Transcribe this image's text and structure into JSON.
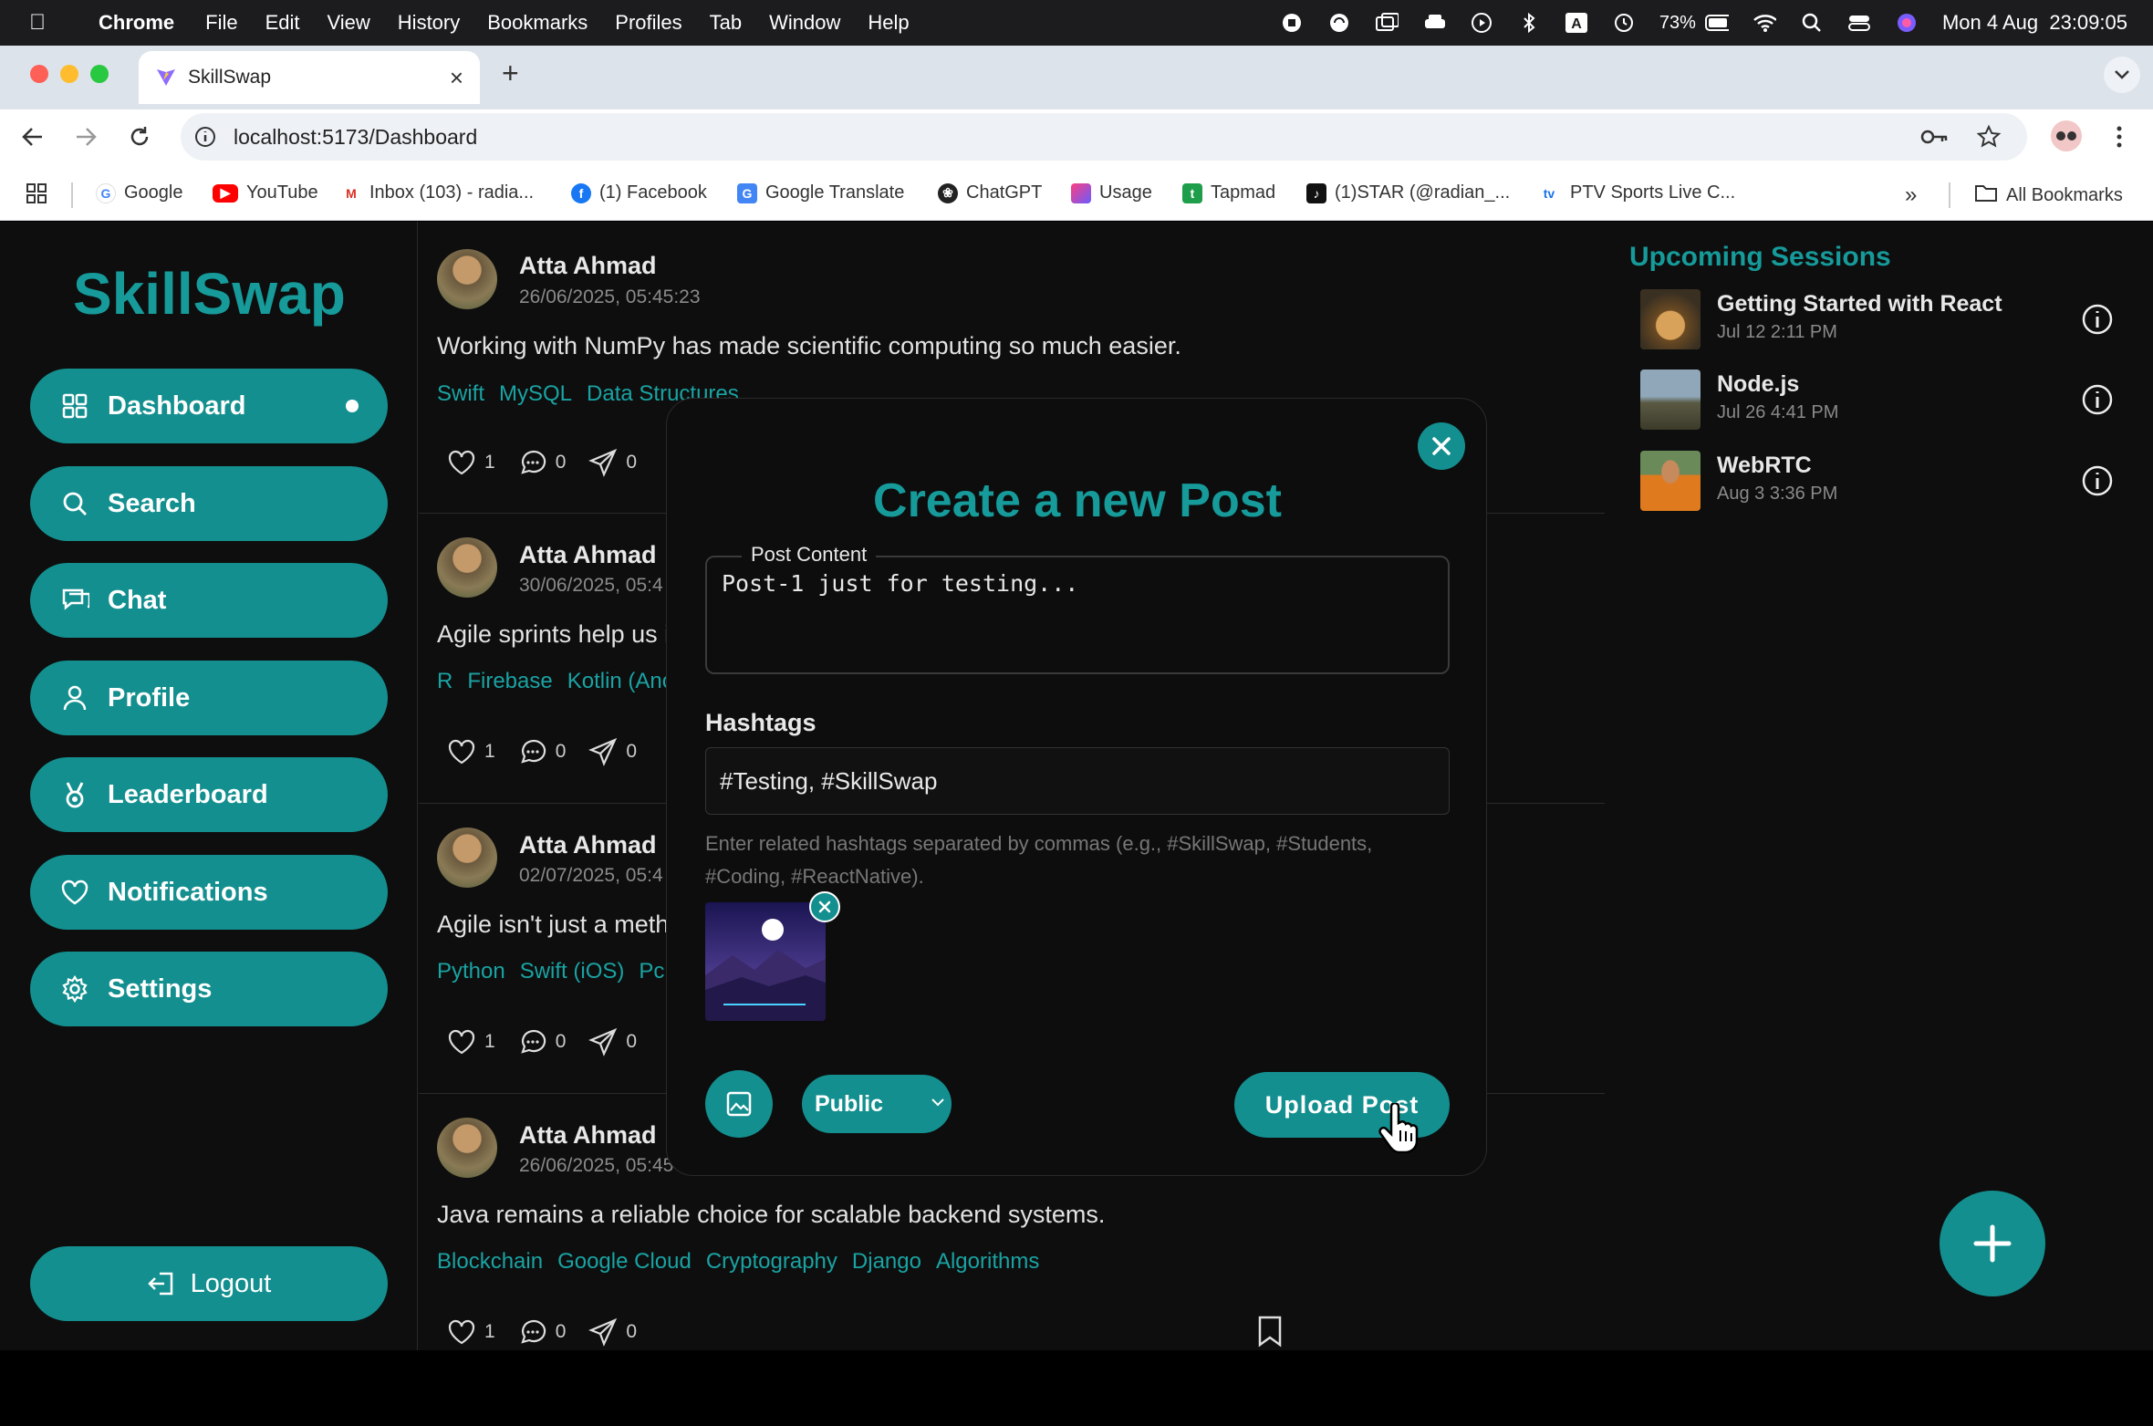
{
  "menubar": {
    "app": "Chrome",
    "items": [
      "File",
      "Edit",
      "View",
      "History",
      "Bookmarks",
      "Profiles",
      "Tab",
      "Window",
      "Help"
    ],
    "battery": "73%",
    "datetime": "Mon 4 Aug  23:09:05"
  },
  "browser": {
    "tab_title": "SkillSwap",
    "url": "localhost:5173/Dashboard",
    "bookmarks": [
      "Google",
      "YouTube",
      "Inbox (103) - radia...",
      "(1) Facebook",
      "Google Translate",
      "ChatGPT",
      "Usage",
      "Tapmad",
      "(1)STAR (@radian_...",
      "PTV Sports Live C..."
    ],
    "all_bookmarks": "All Bookmarks"
  },
  "sidebar": {
    "logo": "SkillSwap",
    "items": [
      {
        "label": "Dashboard",
        "icon": "grid-icon"
      },
      {
        "label": "Search",
        "icon": "search-icon"
      },
      {
        "label": "Chat",
        "icon": "chat-icon"
      },
      {
        "label": "Profile",
        "icon": "user-icon"
      },
      {
        "label": "Leaderboard",
        "icon": "medal-icon"
      },
      {
        "label": "Notifications",
        "icon": "heart-icon"
      },
      {
        "label": "Settings",
        "icon": "gear-icon"
      }
    ],
    "logout": "Logout"
  },
  "feed": {
    "posts": [
      {
        "author": "Atta Ahmad",
        "date": "26/06/2025, 05:45:23",
        "text": "Working with NumPy has made scientific computing so much easier.",
        "tags": [
          "Swift",
          "MySQL",
          "Data Structures"
        ],
        "likes": "1",
        "comments": "0",
        "shares": "0"
      },
      {
        "author": "Atta Ahmad",
        "date": "30/06/2025, 05:4",
        "text": "Agile sprints help us i",
        "tags": [
          "R",
          "Firebase",
          "Kotlin (Anc"
        ],
        "likes": "1",
        "comments": "0",
        "shares": "0"
      },
      {
        "author": "Atta Ahmad",
        "date": "02/07/2025, 05:4",
        "text": "Agile isn't just a meth",
        "tags": [
          "Python",
          "Swift (iOS)",
          "Pc"
        ],
        "likes": "1",
        "comments": "0",
        "shares": "0"
      },
      {
        "author": "Atta Ahmad",
        "date": "26/06/2025, 05:45",
        "text": "Java remains a reliable choice for scalable backend systems.",
        "tags": [
          "Blockchain",
          "Google Cloud",
          "Cryptography",
          "Django",
          "Algorithms"
        ],
        "likes": "1",
        "comments": "0",
        "shares": "0"
      }
    ]
  },
  "sessions": {
    "title": "Upcoming Sessions",
    "items": [
      {
        "title": "Getting Started with React",
        "time": "Jul 12 2:11 PM"
      },
      {
        "title": "Node.js",
        "time": "Jul 26 4:41 PM"
      },
      {
        "title": "WebRTC",
        "time": "Aug 3 3:36 PM"
      }
    ]
  },
  "modal": {
    "title": "Create a new Post",
    "content_label": "Post Content",
    "content_value": "Post-1 just for testing...",
    "hashtags_label": "Hashtags",
    "hashtags_value": "#Testing, #SkillSwap",
    "hint": "Enter related hashtags separated by commas (e.g., #SkillSwap, #Students, #Coding, #ReactNative).",
    "visibility": "Public",
    "upload": "Upload Post"
  },
  "colors": {
    "accent": "#148f8f",
    "title": "#169a9a",
    "bg": "#0e0e0e"
  }
}
